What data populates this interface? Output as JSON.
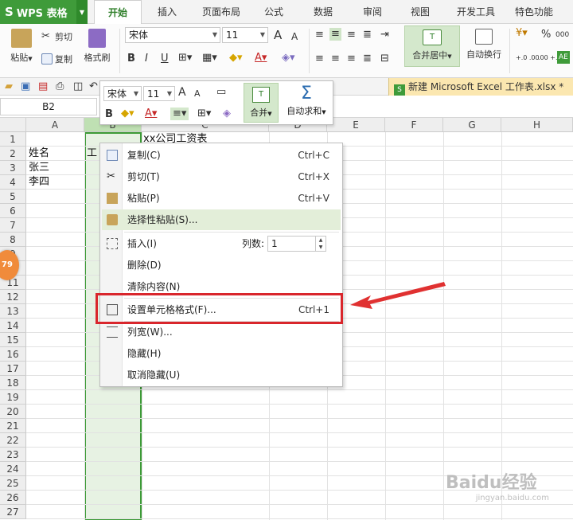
{
  "app": {
    "name": "WPS 表格",
    "logo": "S"
  },
  "tabs": [
    {
      "label": "开始",
      "active": true
    },
    {
      "label": "插入"
    },
    {
      "label": "页面布局"
    },
    {
      "label": "公式"
    },
    {
      "label": "数据"
    },
    {
      "label": "审阅"
    },
    {
      "label": "视图"
    },
    {
      "label": "开发工具"
    },
    {
      "label": "特色功能"
    }
  ],
  "ribbon": {
    "paste": "粘贴",
    "cut": "剪切",
    "copy": "复制",
    "format_painter": "格式刷",
    "font_name": "宋体",
    "font_size": "11",
    "bold": "B",
    "italic": "I",
    "underline": "U",
    "grow_font": "A",
    "shrink_font": "A",
    "merge_center": "合并居中",
    "wrap_text": "自动换行",
    "percent": "%",
    "thousands": "000",
    "inc_decimal": "+.0 .00",
    "dec_decimal": ".00 +.0"
  },
  "file_tab": {
    "name": "新建 Microsoft Excel 工作表.xlsx *",
    "icon_text": "S"
  },
  "namebox": "B2",
  "mini_toolbar": {
    "font_name": "宋体",
    "font_size": "11",
    "bold": "B",
    "merge": "合并",
    "autosum": "自动求和",
    "sigma": "Σ"
  },
  "columns": [
    "A",
    "B",
    "C",
    "D",
    "E",
    "F",
    "G",
    "H"
  ],
  "rows": [
    "1",
    "2",
    "3",
    "4",
    "5",
    "6",
    "7",
    "8",
    "9",
    "10",
    "11",
    "12",
    "13",
    "14",
    "15",
    "16",
    "17",
    "18",
    "19",
    "20",
    "21",
    "22",
    "23",
    "24",
    "25",
    "26",
    "27"
  ],
  "cells": {
    "c1": "xx公司工资表",
    "a2": "姓名",
    "b2": "工",
    "a3": "张三",
    "a4": "李四"
  },
  "context_menu": {
    "copy": "复制(C)",
    "copy_sc": "Ctrl+C",
    "cut": "剪切(T)",
    "cut_sc": "Ctrl+X",
    "paste": "粘贴(P)",
    "paste_sc": "Ctrl+V",
    "paste_special": "选择性粘贴(S)...",
    "insert": "插入(I)",
    "col_count_label": "列数:",
    "col_count_value": "1",
    "delete": "删除(D)",
    "clear": "清除内容(N)",
    "format_cells": "设置单元格格式(F)...",
    "format_cells_sc": "Ctrl+1",
    "col_width": "列宽(W)...",
    "hide": "隐藏(H)",
    "unhide": "取消隐藏(U)"
  },
  "badge": "79",
  "watermark": {
    "brand": "Baidu经验",
    "url": "jingyan.baidu.com"
  },
  "colors": {
    "accent": "#3f9b3a",
    "highlight": "#d9262c"
  }
}
